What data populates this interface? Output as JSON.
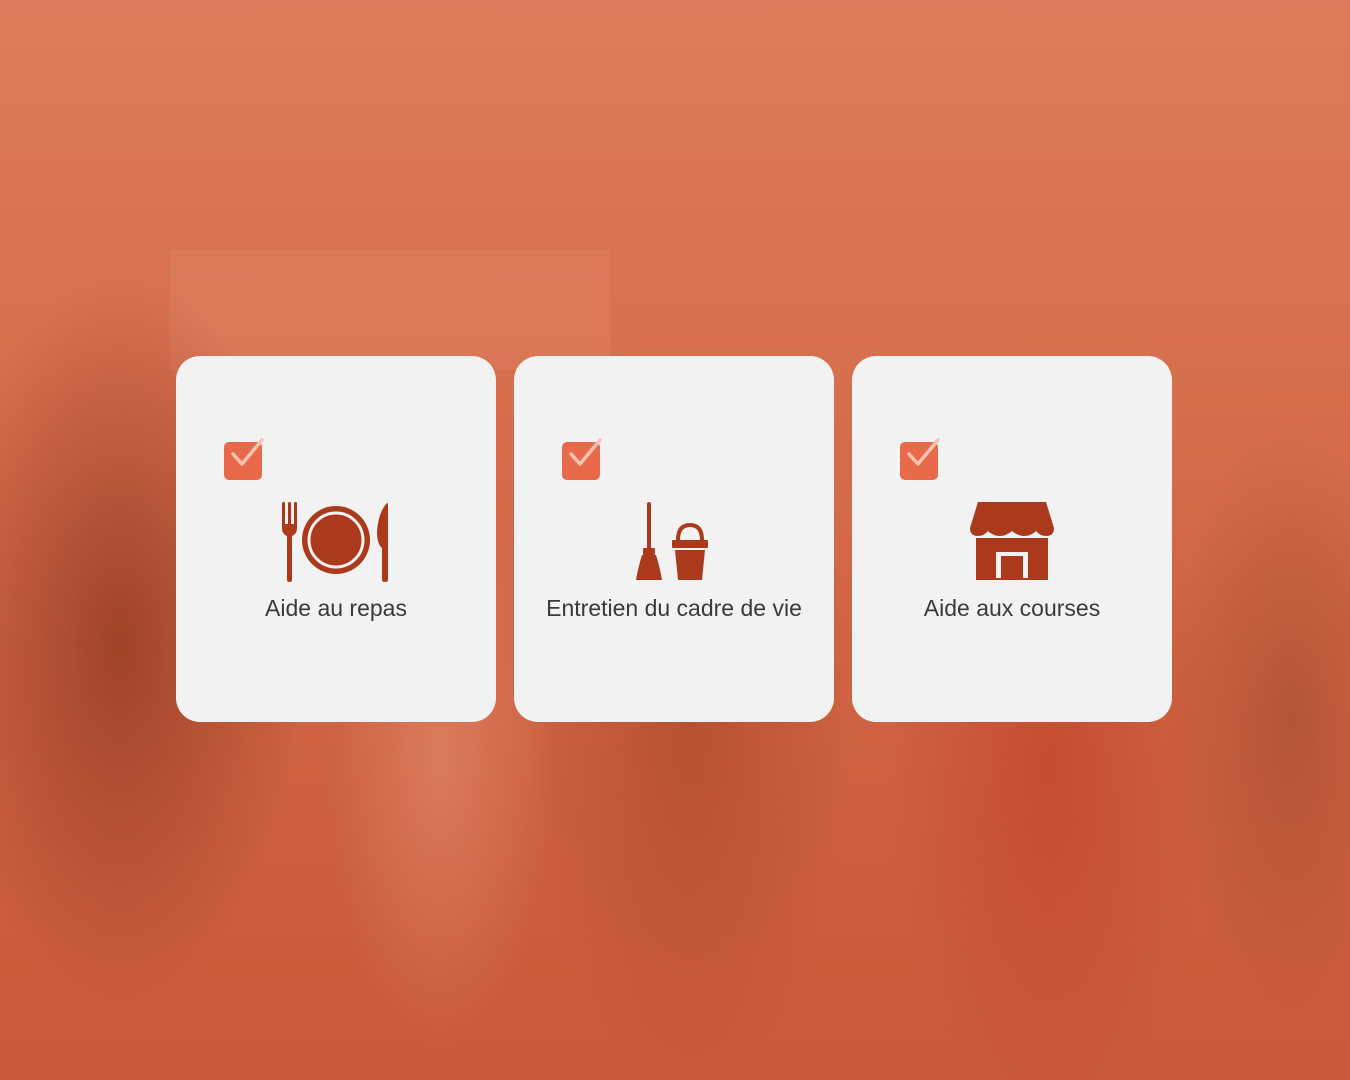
{
  "theme": {
    "accent": "#e86a4a",
    "icon_color": "#ab3a1c",
    "card_background": "#f2f2f2",
    "overlay_color": "#db7654"
  },
  "services": [
    {
      "label": "Aide au repas",
      "icon": "fork-plate-knife-icon",
      "checked": true
    },
    {
      "label": "Entretien du cadre de vie",
      "icon": "broom-bucket-icon",
      "checked": true
    },
    {
      "label": "Aide aux courses",
      "icon": "shop-storefront-icon",
      "checked": true
    }
  ]
}
